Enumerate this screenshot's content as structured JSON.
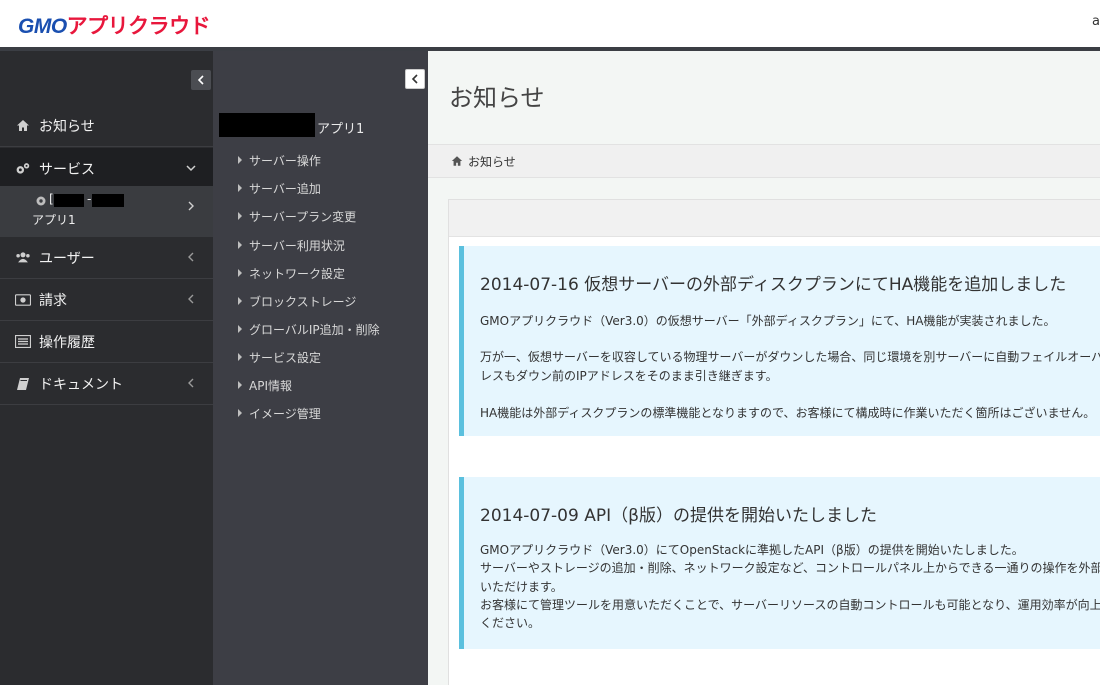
{
  "header": {
    "logo_gmo": "GMO",
    "logo_app": "アプリクラウド",
    "user_text": "a"
  },
  "sidebar": {
    "items": [
      {
        "label": "お知らせ",
        "icon": "home-icon"
      },
      {
        "label": "サービス",
        "icon": "gears-icon"
      },
      {
        "label": "ユーザー",
        "icon": "users-icon"
      },
      {
        "label": "請求",
        "icon": "money-icon"
      },
      {
        "label": "操作履歴",
        "icon": "list-icon"
      },
      {
        "label": "ドキュメント",
        "icon": "book-icon"
      }
    ],
    "sub_item": {
      "prefix": "[",
      "separator": "-",
      "label": "アプリ1"
    }
  },
  "submenu": {
    "app_name": "アプリ1",
    "items": [
      "サーバー操作",
      "サーバー追加",
      "サーバープラン変更",
      "サーバー利用状況",
      "ネットワーク設定",
      "ブロックストレージ",
      "グローバルIP追加・削除",
      "サービス設定",
      "API情報",
      "イメージ管理"
    ]
  },
  "content": {
    "page_title": "お知らせ",
    "breadcrumb": "お知らせ",
    "notices": [
      {
        "title": "2014-07-16 仮想サーバーの外部ディスクプランにてHA機能を追加しました",
        "paragraphs": [
          "GMOアプリクラウド（Ver3.0）の仮想サーバー「外部ディスクプラン」にて、HA機能が実装されました。",
          "万が一、仮想サーバーを収容している物理サーバーがダウンした場合、同じ環境を別サーバーに自動フェイルオーバ",
          "レスもダウン前のIPアドレスをそのまま引き継ぎます。",
          "HA機能は外部ディスクプランの標準機能となりますので、お客様にて構成時に作業いただく箇所はございません。"
        ]
      },
      {
        "title": "2014-07-09 API（β版）の提供を開始いたしました",
        "paragraphs": [
          "GMOアプリクラウド（Ver3.0）にてOpenStackに準拠したAPI（β版）の提供を開始いたしました。",
          "サーバーやストレージの追加・削除、ネットワーク設定など、コントロールパネル上からできる一通りの操作を外部プロ",
          "いただけます。",
          "お客様にて管理ツールを用意いただくことで、サーバーリソースの自動コントロールも可能となり、運用効率が向上し",
          "ください。"
        ]
      }
    ]
  }
}
